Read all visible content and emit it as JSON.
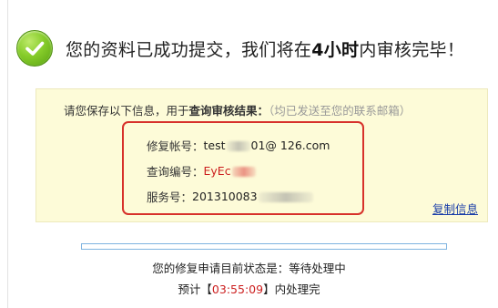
{
  "headline": {
    "prefix": "您的资料已成功提交，我们将在",
    "emphasis": "4小时",
    "suffix": "内审核完毕！"
  },
  "notice": {
    "lead": "请您保存以下信息，用于",
    "strong": "查询审核结果：",
    "muted": "（均已发送至您的联系邮箱）"
  },
  "info": {
    "account_label": "修复帐号：",
    "account_prefix": "test",
    "account_suffix": "01@ 126.com",
    "query_label": "查询编号：",
    "query_prefix": "EyEc",
    "service_label": "服务号：",
    "service_prefix": "201310083"
  },
  "actions": {
    "copy_label": "复制信息"
  },
  "progress": {
    "fraction": 0
  },
  "status": {
    "text": "您的修复申请目前状态是：等待处理中"
  },
  "eta": {
    "lead": "预计【",
    "countdown": "03:55:09",
    "tail": "】内处理完"
  },
  "colors": {
    "accent_red": "#cc1f1f",
    "panel_bg": "#fdfbd8",
    "link_blue": "#1a3ea8",
    "success_green": "#86cc2a"
  },
  "icons": {
    "status": "check-circle-icon"
  }
}
